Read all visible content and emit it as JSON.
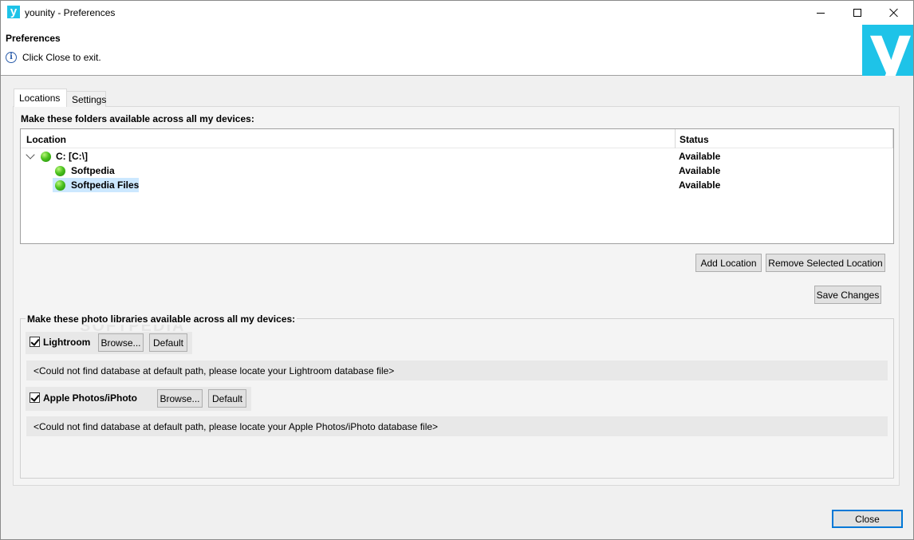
{
  "window": {
    "title": "younity - Preferences",
    "app_icon_letter": "y"
  },
  "header": {
    "title": "Preferences",
    "info_text": "Click Close to exit.",
    "logo_letter": "y",
    "brand_color": "#1ec3e8"
  },
  "tabs": [
    {
      "label": "Locations",
      "active": true
    },
    {
      "label": "Settings",
      "active": false
    }
  ],
  "locations": {
    "section_label": "Make these folders available across all my devices:",
    "columns": {
      "location": "Location",
      "status": "Status"
    },
    "rows": [
      {
        "label": "C:  [C:\\]",
        "status": "Available",
        "expanded": true,
        "level": 0,
        "selected": false
      },
      {
        "label": "Softpedia",
        "status": "Available",
        "level": 1,
        "selected": false
      },
      {
        "label": "Softpedia Files",
        "status": "Available",
        "level": 1,
        "selected": true
      }
    ],
    "add_button": "Add Location",
    "remove_button": "Remove Selected Location",
    "save_button": "Save Changes"
  },
  "libraries": {
    "section_label": "Make these photo libraries available across all my devices:",
    "items": [
      {
        "name": "Lightroom",
        "checked": true,
        "browse": "Browse...",
        "default": "Default",
        "message": "<Could not find database at default path, please locate your Lightroom database file>"
      },
      {
        "name": "Apple Photos/iPhoto",
        "checked": true,
        "browse": "Browse...",
        "default": "Default",
        "message": "<Could not find database at default path, please locate your Apple Photos/iPhoto database file>"
      }
    ]
  },
  "footer": {
    "close_button": "Close"
  }
}
